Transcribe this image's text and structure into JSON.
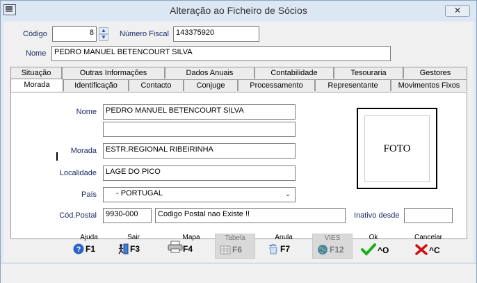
{
  "window": {
    "title": "Alteração ao Ficheiro de Sócios",
    "close_label": "✕"
  },
  "header": {
    "codigo_label": "Código",
    "codigo_value": "8",
    "numero_fiscal_label": "Número Fiscal",
    "numero_fiscal_value": "143375920",
    "nome_label": "Nome",
    "nome_value": "PEDRO MANUEL BETENCOURT SILVA"
  },
  "tabs_row1": [
    {
      "label": "Situação"
    },
    {
      "label": "Outras Informações"
    },
    {
      "label": "Dados Anuais"
    },
    {
      "label": "Contabilidade"
    },
    {
      "label": "Tesouraria"
    },
    {
      "label": "Gestores"
    }
  ],
  "tabs_row2": [
    {
      "label": "Morada",
      "active": true
    },
    {
      "label": "Identificação"
    },
    {
      "label": "Contacto"
    },
    {
      "label": "Conjuge"
    },
    {
      "label": "Processamento"
    },
    {
      "label": "Representante"
    },
    {
      "label": "Movimentos Fixos"
    }
  ],
  "morada": {
    "nome_label": "Nome",
    "nome_value": "PEDRO MANUEL BETENCOURT SILVA",
    "nome2_value": "",
    "morada_label": "Morada",
    "morada_value": "ESTR.REGIONAL RIBEIRINHA",
    "localidade_label": "Localidade",
    "localidade_value": "LAGE DO PICO",
    "pais_label": "País",
    "pais_value": "- PORTUGAL",
    "cod_postal_label": "Cód.Postal",
    "cod_postal_value": "9930-000",
    "cod_postal_desc": "Codigo Postal nao Existe !!",
    "inativo_label": "Inativo desde",
    "inativo_value": "",
    "foto_label": "FOTO"
  },
  "buttons": [
    {
      "label": "Ajuda",
      "key": "F1",
      "icon": "help-icon",
      "enabled": true
    },
    {
      "label": "Sair",
      "key": "F3",
      "icon": "exit-icon",
      "enabled": true
    },
    {
      "label": "Mapa",
      "key": "F4",
      "icon": "printer-icon",
      "enabled": true
    },
    {
      "label": "Tabela",
      "key": "F6",
      "icon": "table-icon",
      "enabled": false
    },
    {
      "label": "Anula",
      "key": "F7",
      "icon": "undo-icon",
      "enabled": true
    },
    {
      "label": "VIES",
      "key": "F12",
      "icon": "globe-icon",
      "enabled": false
    },
    {
      "label": "Ok",
      "key": "^O",
      "icon": "checkmark-icon",
      "enabled": true
    },
    {
      "label": "Cancelar",
      "key": "^C",
      "icon": "x-icon",
      "enabled": true
    }
  ],
  "colors": {
    "label": "#1c2a68",
    "check": "#18b018",
    "cancel": "#d01010",
    "help": "#2a62c9"
  }
}
